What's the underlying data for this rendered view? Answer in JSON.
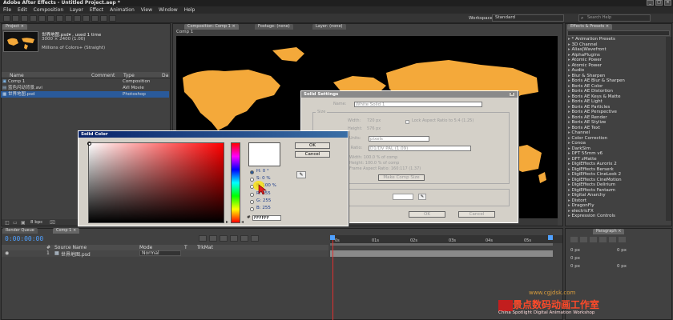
{
  "window": {
    "title": "Adobe After Effects - Untitled Project.aep *",
    "controls": [
      "_",
      "□",
      "×"
    ]
  },
  "menu": [
    "File",
    "Edit",
    "Composition",
    "Layer",
    "Effect",
    "Animation",
    "View",
    "Window",
    "Help"
  ],
  "toolbar": {
    "workspace_label": "Workspace:",
    "workspace_value": "Standard",
    "search_placeholder": "Search Help"
  },
  "project": {
    "tab": "Project ×",
    "item_name": "世界地图.psd▾ , used 1 time",
    "item_size": "3000 × 2400 (1.00)",
    "item_colors": "Millions of Colors+ (Straight)",
    "columns": [
      "Name",
      "Comment",
      "Type",
      "Da"
    ],
    "items": [
      {
        "name": "Comp 1",
        "type": "Composition"
      },
      {
        "name": "蓝色闪动背景.avi",
        "type": "AVI Movie"
      },
      {
        "name": "世界地图.psd",
        "type": "Photoshop"
      }
    ],
    "bpc": "8 bpc"
  },
  "comp": {
    "tabs": [
      "Composition: Comp 1 ×",
      "Footage: (none)",
      "Layer: (none)"
    ],
    "breadcrumb": "Comp 1"
  },
  "effects": {
    "tab": "Effects & Presets ×",
    "search_placeholder": "",
    "items": [
      "* Animation Presets",
      "3D Channel",
      "Alias|Wavefront",
      "AlphaPlugins",
      "Atomic Power",
      "Atomic Power",
      "Audio",
      "Blur & Sharpen",
      "Boris AE Blur & Sharpen",
      "Boris AE Color",
      "Boris AE Distortion",
      "Boris AE Keys & Matte",
      "Boris AE Light",
      "Boris AE Particles",
      "Boris AE Perspective",
      "Boris AE Render",
      "Boris AE Stylize",
      "Boris AE Text",
      "Channel",
      "Color Correction",
      "Conoa",
      "DarkSim",
      "DFT 55mm v6",
      "DFT zMatte",
      "DigiEffects Aurorix 2",
      "DigiEffects Berserk",
      "DigiEffects CineLook 2",
      "DigiEffects CineMotion",
      "DigiEffects Delirium",
      "DigiEffects Fantazm",
      "Digital Anarchy",
      "Distort",
      "DragonFly",
      "electricFX",
      "Expression Controls"
    ]
  },
  "paragraph": {
    "tab": "Paragraph ×",
    "values": [
      "0 px",
      "0 px",
      "0 px",
      "0 px",
      "0 px"
    ]
  },
  "timeline": {
    "tabs": [
      "Render Queue",
      "Comp 1 ×"
    ],
    "timecode": "0:00:00:00",
    "columns": [
      "#",
      "Source Name",
      "Mode",
      "T",
      "TrkMat"
    ],
    "layer_num": "1",
    "layer_name": "世界地图.psd",
    "layer_mode": "Normal",
    "ruler": [
      "0s",
      "01s",
      "02s",
      "03s",
      "04s",
      "05s"
    ]
  },
  "solid_color": {
    "title": "Solid Color",
    "ok": "OK",
    "cancel": "Cancel",
    "h_label": "H: 0 °",
    "s_label": "S: 0 %",
    "b_label": "B: 100 %",
    "r_label": "R: 255",
    "g_label": "G: 255",
    "b2_label": "B: 255",
    "hex_prefix": "#",
    "hex_value": "FFFFFF"
  },
  "solid_settings": {
    "title": "Solid Settings",
    "name_label": "Name:",
    "name_value": "White Solid 1",
    "size_label": "Size",
    "width_label": "Width:",
    "width_value": "720 px",
    "lock_label": "Lock Aspect Ratio to 5:4 (1.25)",
    "height_label": "Height:",
    "height_value": "576 px",
    "units_label": "Units:",
    "units_value": "pixels",
    "par_label": "Pixel Aspect Ratio:",
    "par_value": "D1/DV PAL (1.09)",
    "width_pct": "Width: 100.0 % of comp",
    "height_pct": "Height: 100.0 % of comp",
    "frame_ratio": "Frame Aspect Ratio: 160:117 (1.37)",
    "make_comp_size": "Make Comp Size",
    "ok": "OK",
    "cancel": "Cancel"
  },
  "watermark": {
    "main": "景点数码动画工作室",
    "sub": "China Spotlight Digital Animation Workshop",
    "site": "www.cgjdsk.com"
  },
  "colors": {
    "map_orange": "#f4a93a",
    "accent_blue": "#2a5a9a",
    "playhead": "#e03030"
  }
}
